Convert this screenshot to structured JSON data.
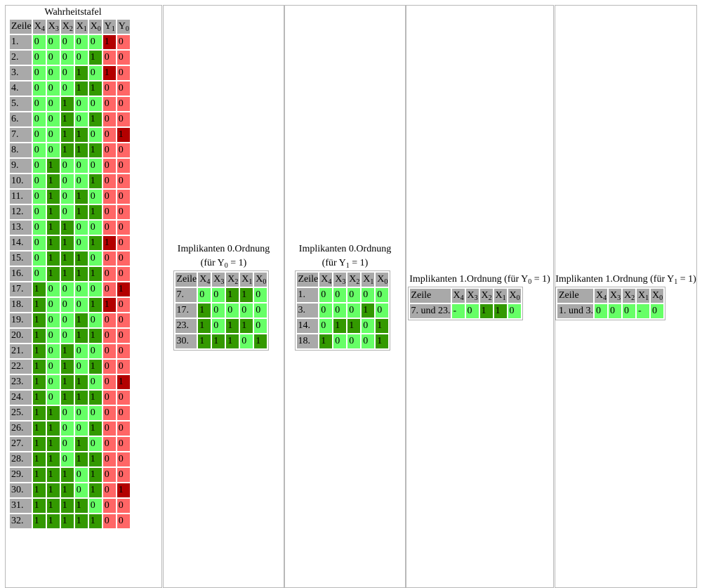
{
  "panels": {
    "truth_table": {
      "title": "Wahrheitstafel",
      "headers": [
        {
          "base": "Zeile",
          "sub": ""
        },
        {
          "base": "X",
          "sub": "4"
        },
        {
          "base": "X",
          "sub": "3"
        },
        {
          "base": "X",
          "sub": "2"
        },
        {
          "base": "X",
          "sub": "1"
        },
        {
          "base": "X",
          "sub": "0"
        },
        {
          "base": "Y",
          "sub": "1"
        },
        {
          "base": "Y",
          "sub": "0"
        }
      ],
      "rows": [
        [
          "1.",
          "0",
          "0",
          "0",
          "0",
          "0",
          "1",
          "0"
        ],
        [
          "2.",
          "0",
          "0",
          "0",
          "0",
          "1",
          "0",
          "0"
        ],
        [
          "3.",
          "0",
          "0",
          "0",
          "1",
          "0",
          "1",
          "0"
        ],
        [
          "4.",
          "0",
          "0",
          "0",
          "1",
          "1",
          "0",
          "0"
        ],
        [
          "5.",
          "0",
          "0",
          "1",
          "0",
          "0",
          "0",
          "0"
        ],
        [
          "6.",
          "0",
          "0",
          "1",
          "0",
          "1",
          "0",
          "0"
        ],
        [
          "7.",
          "0",
          "0",
          "1",
          "1",
          "0",
          "0",
          "1"
        ],
        [
          "8.",
          "0",
          "0",
          "1",
          "1",
          "1",
          "0",
          "0"
        ],
        [
          "9.",
          "0",
          "1",
          "0",
          "0",
          "0",
          "0",
          "0"
        ],
        [
          "10.",
          "0",
          "1",
          "0",
          "0",
          "1",
          "0",
          "0"
        ],
        [
          "11.",
          "0",
          "1",
          "0",
          "1",
          "0",
          "0",
          "0"
        ],
        [
          "12.",
          "0",
          "1",
          "0",
          "1",
          "1",
          "0",
          "0"
        ],
        [
          "13.",
          "0",
          "1",
          "1",
          "0",
          "0",
          "0",
          "0"
        ],
        [
          "14.",
          "0",
          "1",
          "1",
          "0",
          "1",
          "1",
          "0"
        ],
        [
          "15.",
          "0",
          "1",
          "1",
          "1",
          "0",
          "0",
          "0"
        ],
        [
          "16.",
          "0",
          "1",
          "1",
          "1",
          "1",
          "0",
          "0"
        ],
        [
          "17.",
          "1",
          "0",
          "0",
          "0",
          "0",
          "0",
          "1"
        ],
        [
          "18.",
          "1",
          "0",
          "0",
          "0",
          "1",
          "1",
          "0"
        ],
        [
          "19.",
          "1",
          "0",
          "0",
          "1",
          "0",
          "0",
          "0"
        ],
        [
          "20.",
          "1",
          "0",
          "0",
          "1",
          "1",
          "0",
          "0"
        ],
        [
          "21.",
          "1",
          "0",
          "1",
          "0",
          "0",
          "0",
          "0"
        ],
        [
          "22.",
          "1",
          "0",
          "1",
          "0",
          "1",
          "0",
          "0"
        ],
        [
          "23.",
          "1",
          "0",
          "1",
          "1",
          "0",
          "0",
          "1"
        ],
        [
          "24.",
          "1",
          "0",
          "1",
          "1",
          "1",
          "0",
          "0"
        ],
        [
          "25.",
          "1",
          "1",
          "0",
          "0",
          "0",
          "0",
          "0"
        ],
        [
          "26.",
          "1",
          "1",
          "0",
          "0",
          "1",
          "0",
          "0"
        ],
        [
          "27.",
          "1",
          "1",
          "0",
          "1",
          "0",
          "0",
          "0"
        ],
        [
          "28.",
          "1",
          "1",
          "0",
          "1",
          "1",
          "0",
          "0"
        ],
        [
          "29.",
          "1",
          "1",
          "1",
          "0",
          "1",
          "0",
          "0"
        ],
        [
          "30.",
          "1",
          "1",
          "1",
          "0",
          "1",
          "0",
          "1"
        ],
        [
          "31.",
          "1",
          "1",
          "1",
          "1",
          "0",
          "0",
          "0"
        ],
        [
          "32.",
          "1",
          "1",
          "1",
          "1",
          "1",
          "0",
          "0"
        ]
      ]
    },
    "impl0_y0": {
      "title_line1": "Implikanten 0.Ordnung",
      "title_pre": "(für Y",
      "title_sub": "0",
      "title_post": " = 1)",
      "headers": [
        {
          "base": "Zeile",
          "sub": ""
        },
        {
          "base": "X",
          "sub": "4"
        },
        {
          "base": "X",
          "sub": "3"
        },
        {
          "base": "X",
          "sub": "2"
        },
        {
          "base": "X",
          "sub": "1"
        },
        {
          "base": "X",
          "sub": "0"
        }
      ],
      "rows": [
        [
          "7.",
          "0",
          "0",
          "1",
          "1",
          "0"
        ],
        [
          "17.",
          "1",
          "0",
          "0",
          "0",
          "0"
        ],
        [
          "23.",
          "1",
          "0",
          "1",
          "1",
          "0"
        ],
        [
          "30.",
          "1",
          "1",
          "1",
          "0",
          "1"
        ]
      ]
    },
    "impl0_y1": {
      "title_line1": "Implikanten 0.Ordnung",
      "title_pre": "(für Y",
      "title_sub": "1",
      "title_post": " = 1)",
      "headers": [
        {
          "base": "Zeile",
          "sub": ""
        },
        {
          "base": "X",
          "sub": "4"
        },
        {
          "base": "X",
          "sub": "3"
        },
        {
          "base": "X",
          "sub": "2"
        },
        {
          "base": "X",
          "sub": "1"
        },
        {
          "base": "X",
          "sub": "0"
        }
      ],
      "rows": [
        [
          "1.",
          "0",
          "0",
          "0",
          "0",
          "0"
        ],
        [
          "3.",
          "0",
          "0",
          "0",
          "1",
          "0"
        ],
        [
          "14.",
          "0",
          "1",
          "1",
          "0",
          "1"
        ],
        [
          "18.",
          "1",
          "0",
          "0",
          "0",
          "1"
        ]
      ]
    },
    "impl1_y0": {
      "title_pre": "Implikanten 1.Ordnung (für Y",
      "title_sub": "0",
      "title_post": " = 1)",
      "headers": [
        {
          "base": "Zeile",
          "sub": ""
        },
        {
          "base": "X",
          "sub": "4"
        },
        {
          "base": "X",
          "sub": "3"
        },
        {
          "base": "X",
          "sub": "2"
        },
        {
          "base": "X",
          "sub": "1"
        },
        {
          "base": "X",
          "sub": "0"
        }
      ],
      "rows": [
        [
          "7. und 23.",
          "-",
          "0",
          "1",
          "1",
          "0"
        ]
      ]
    },
    "impl1_y1": {
      "title_pre": "Implikanten 1.Ordnung (für Y",
      "title_sub": "1",
      "title_post": " = 1)",
      "headers": [
        {
          "base": "Zeile",
          "sub": ""
        },
        {
          "base": "X",
          "sub": "4"
        },
        {
          "base": "X",
          "sub": "3"
        },
        {
          "base": "X",
          "sub": "2"
        },
        {
          "base": "X",
          "sub": "1"
        },
        {
          "base": "X",
          "sub": "0"
        }
      ],
      "rows": [
        [
          "1. und 3.",
          "0",
          "0",
          "0",
          "-",
          "0"
        ]
      ]
    }
  },
  "colors": {
    "header_gray": "#a9a9a9",
    "input_zero": "#66ff66",
    "input_one": "#339900",
    "output_zero": "#ff6666",
    "output_one": "#b30000"
  }
}
